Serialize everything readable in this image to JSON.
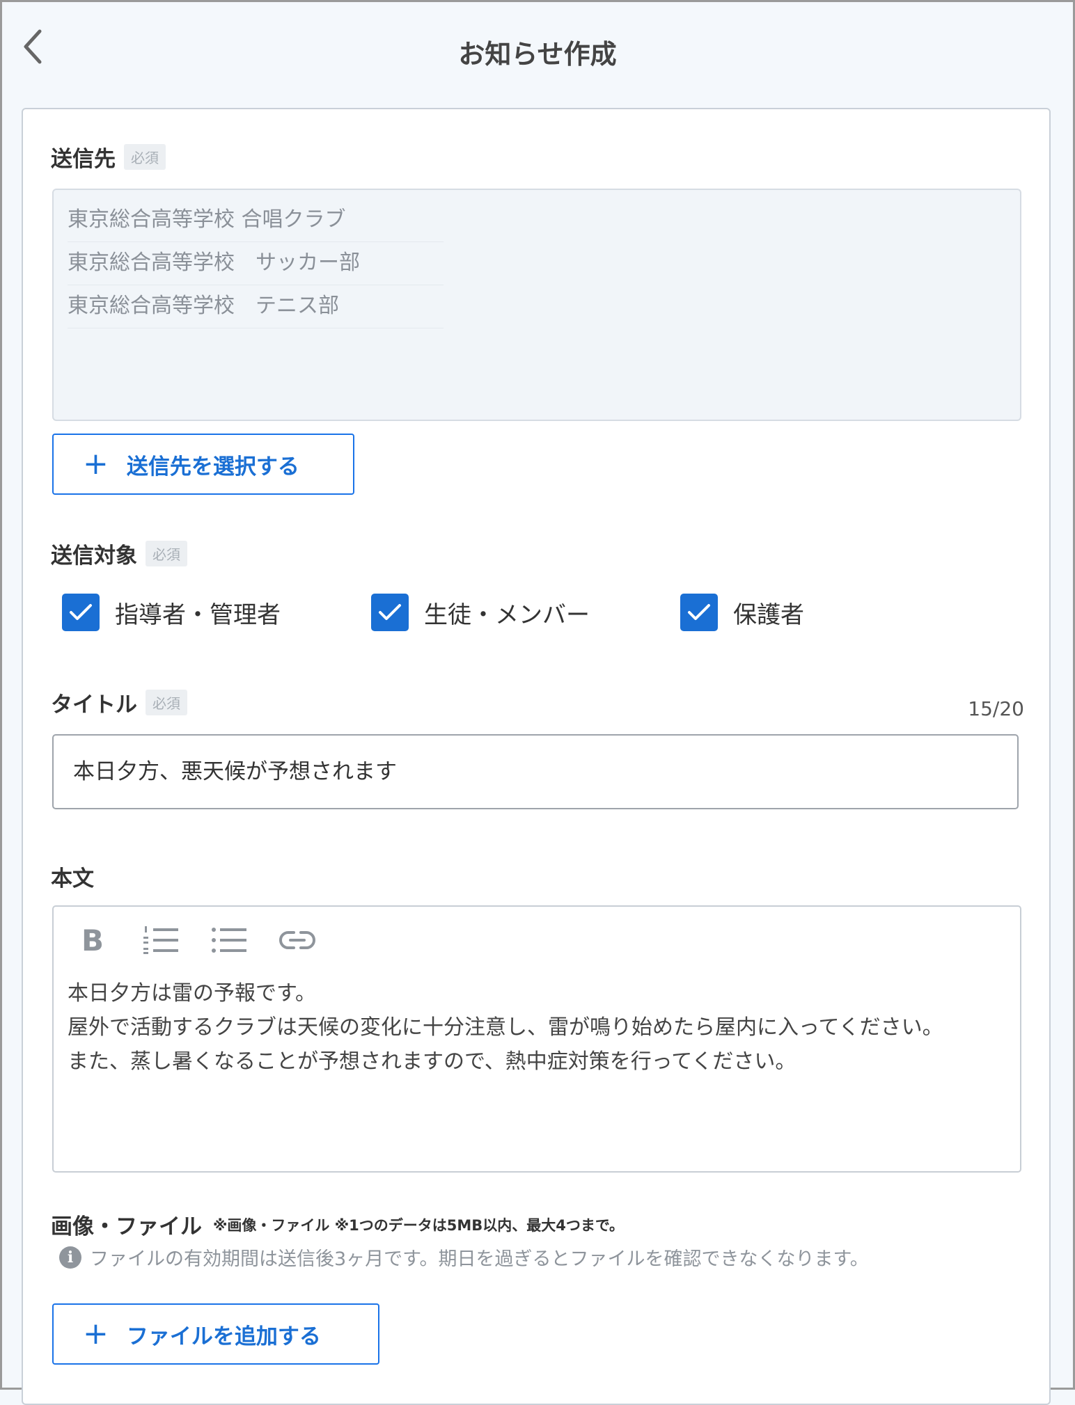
{
  "header": {
    "title": "お知らせ作成",
    "back_icon": "chevron-left-icon"
  },
  "destination": {
    "label": "送信先",
    "required_badge": "必須",
    "items": [
      "東京総合高等学校 合唱クラブ",
      "東京総合高等学校　サッカー部",
      "東京総合高等学校　テニス部"
    ],
    "select_button": "送信先を選択する"
  },
  "target": {
    "label": "送信対象",
    "required_badge": "必須",
    "options": [
      {
        "label": "指導者・管理者",
        "checked": true
      },
      {
        "label": "生徒・メンバー",
        "checked": true
      },
      {
        "label": "保護者",
        "checked": true
      }
    ]
  },
  "title_field": {
    "label": "タイトル",
    "required_badge": "必須",
    "counter": "15/20",
    "value": "本日夕方、悪天候が予想されます"
  },
  "body": {
    "label": "本文",
    "toolbar": [
      "bold-icon",
      "ordered-list-icon",
      "bullet-list-icon",
      "link-icon"
    ],
    "text": "本日夕方は雷の予報です。\n屋外で活動するクラブは天候の変化に十分注意し、雷が鳴り始めたら屋内に入ってください。\nまた、蒸し暑くなることが予想されますので、熱中症対策を行ってください。"
  },
  "files": {
    "label": "画像・ファイル",
    "note": "※画像・ファイル ※1つのデータは5MB以内、最大4つまで。",
    "info": "ファイルの有効期間は送信後3ヶ月です。期日を過ぎるとファイルを確認できなくなります。",
    "add_button": "ファイルを追加する"
  },
  "colors": {
    "accent": "#1a6fd4",
    "page_bg": "#f4f8fc",
    "badge_bg": "#eceff2"
  }
}
